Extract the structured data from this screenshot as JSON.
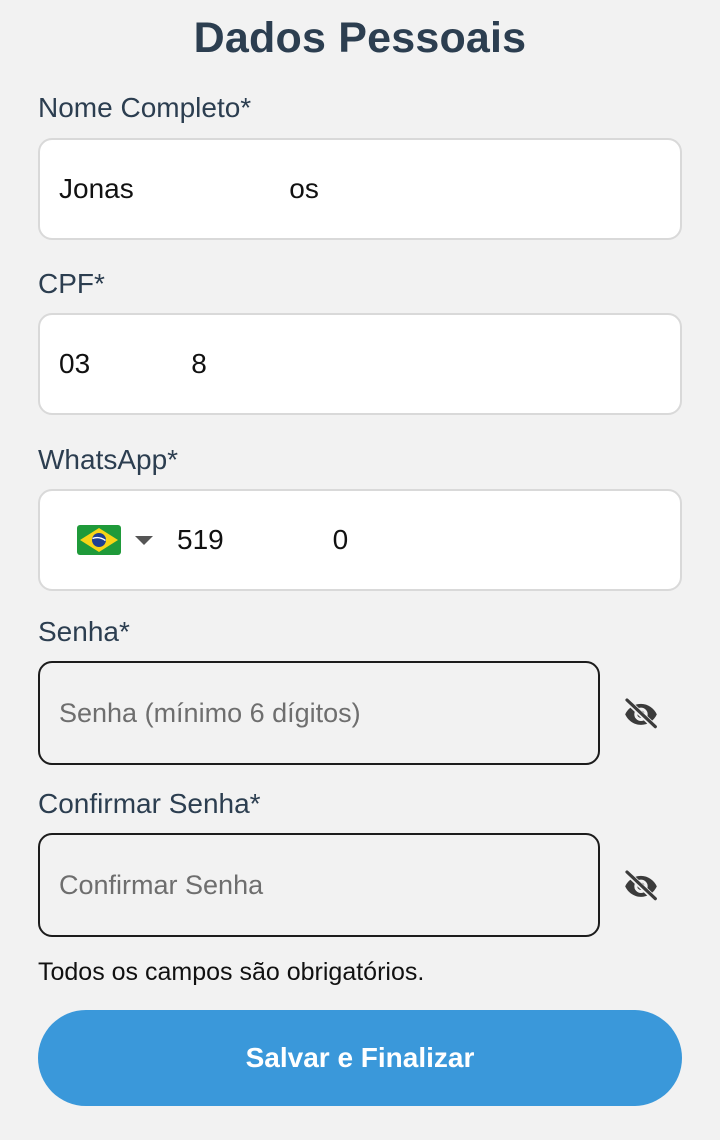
{
  "page": {
    "title": "Dados Pessoais"
  },
  "form": {
    "name": {
      "label": "Nome Completo*",
      "value": "Jonas                    os"
    },
    "cpf": {
      "label": "CPF*",
      "value": "03             8"
    },
    "whatsapp": {
      "label": "WhatsApp*",
      "country_flag": "brazil-flag-icon",
      "value": "519              0"
    },
    "password": {
      "label": "Senha*",
      "placeholder": "Senha (mínimo 6 dígitos)",
      "toggle_icon": "eye-off-icon"
    },
    "confirm_password": {
      "label": "Confirmar Senha*",
      "placeholder": "Confirmar Senha",
      "toggle_icon": "eye-off-icon"
    },
    "note": "Todos os campos são obrigatórios.",
    "submit_label": "Salvar e Finalizar"
  },
  "colors": {
    "background": "#f2f2f2",
    "heading": "#2c3e50",
    "button": "#3a98da",
    "button_text": "#ffffff"
  }
}
